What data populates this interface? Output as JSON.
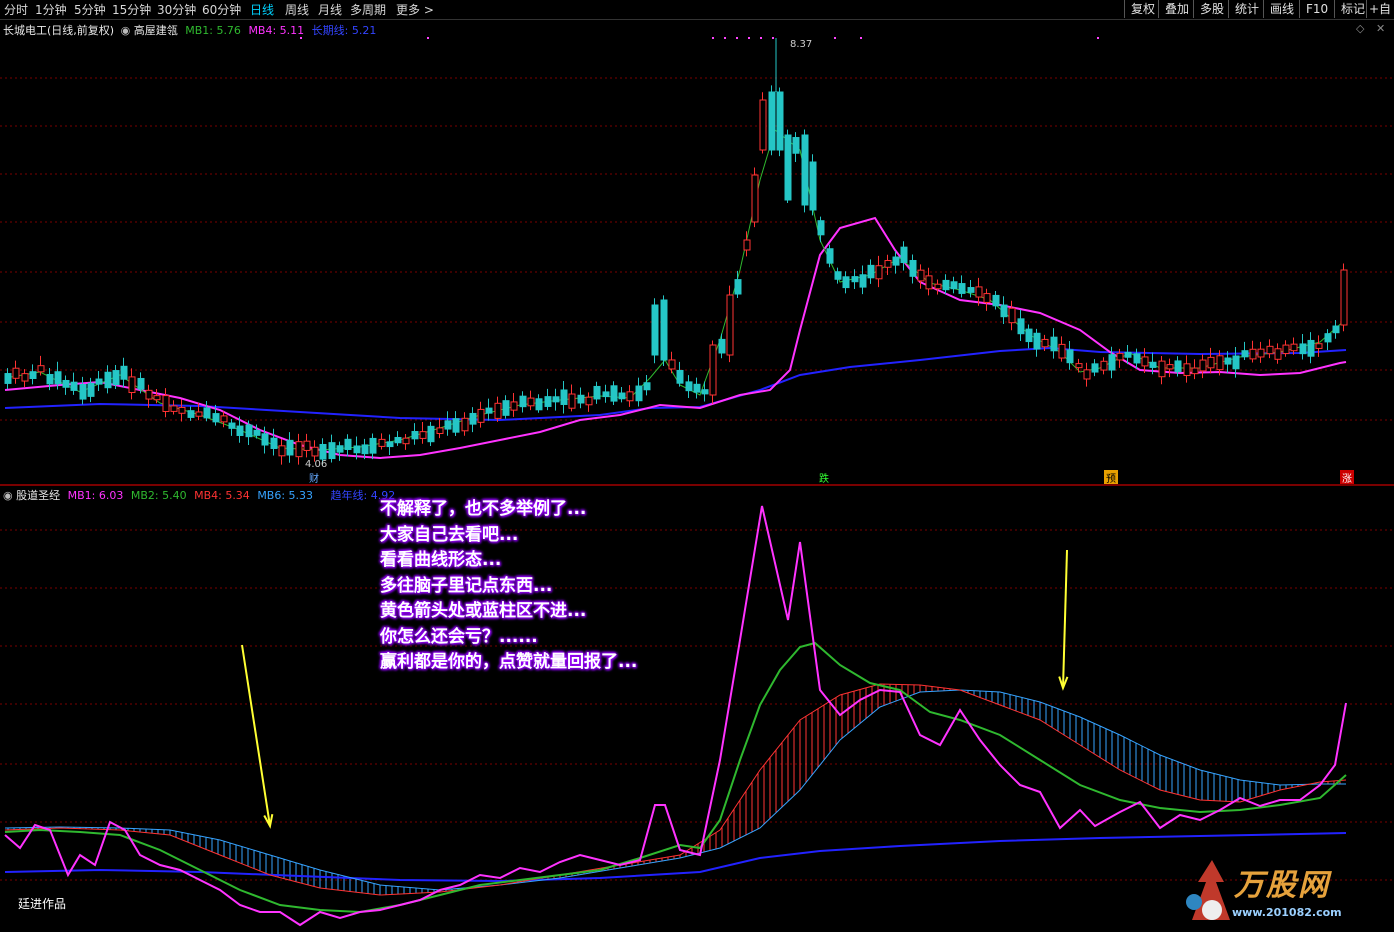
{
  "topbar": {
    "periods": [
      "分时",
      "1分钟",
      "5分钟",
      "15分钟",
      "30分钟",
      "60分钟",
      "日线",
      "周线",
      "月线",
      "多周期",
      "更多 >"
    ],
    "active_period": "日线",
    "tools": [
      "复权",
      "叠加",
      "多股",
      "统计",
      "画线",
      "F10",
      "标记",
      "+自"
    ]
  },
  "main_title": {
    "stock": "长城电工(日线,前复权)",
    "indicator": "高屋建瓴",
    "mb1_label": "MB1: 5.76",
    "mb4_label": "MB4: 5.11",
    "long_label": "长期线: 5.21"
  },
  "price_labels": {
    "high": "8.37",
    "low": "4.06"
  },
  "markers": [
    "财",
    "跌",
    "预",
    "涨"
  ],
  "sub_title": {
    "indicator": "股道圣经",
    "mb1_label": "MB1: 6.03",
    "mb2_label": "MB2: 5.40",
    "mb4_label": "MB4: 5.34",
    "mb6_label": "MB6: 5.33",
    "long_label": "趋年线: 4.92"
  },
  "annotation_lines": [
    "不解释了，也不多举例了...",
    "大家自己去看吧...",
    "看看曲线形态...",
    "多往脑子里记点东西...",
    "黄色箭头处或蓝柱区不进...",
    "你怎么还会亏？......",
    "赢利都是你的，点赞就量回报了..."
  ],
  "author": "廷进作品",
  "logo": {
    "text": "万股网",
    "url": "www.201082.com"
  },
  "colors": {
    "up": "#ff3333",
    "down": "#25c6c6",
    "mb1": "#ff33ff",
    "mb2": "#2fb82f",
    "mb4": "#ff3333",
    "mb6": "#36a3ff",
    "long": "#2222ff",
    "arrow": "#ffff33"
  }
}
